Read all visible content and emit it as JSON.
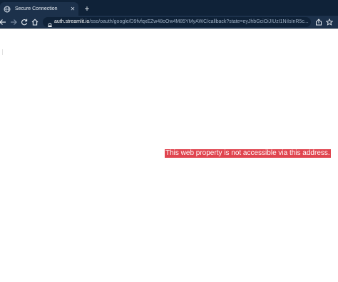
{
  "tab": {
    "title": "Secure Connection",
    "close_glyph": "✕",
    "favicon": "globe-icon"
  },
  "new_tab": {
    "glyph": "+"
  },
  "toolbar": {
    "back_icon": "back-arrow-icon",
    "forward_icon": "forward-arrow-icon",
    "reload_icon": "reload-icon",
    "home_icon": "home-icon",
    "share_icon": "share-icon",
    "bookmark_icon": "star-icon"
  },
  "omnibox": {
    "host": "auth.streamlit.io",
    "path": "/sso/oauth/google/D9fvfqxEZw48oOw4M85YMyAWC/callback?state=eyJhbGciOiJIUzI1NiIsInR5c..."
  },
  "page": {
    "error_message": "This web property is not accessible via this address."
  },
  "colors": {
    "tabstrip_bg": "#0f2238",
    "toolbar_bg": "#1c314b",
    "error_bg": "#e0454f",
    "error_text": "#ffffff"
  }
}
